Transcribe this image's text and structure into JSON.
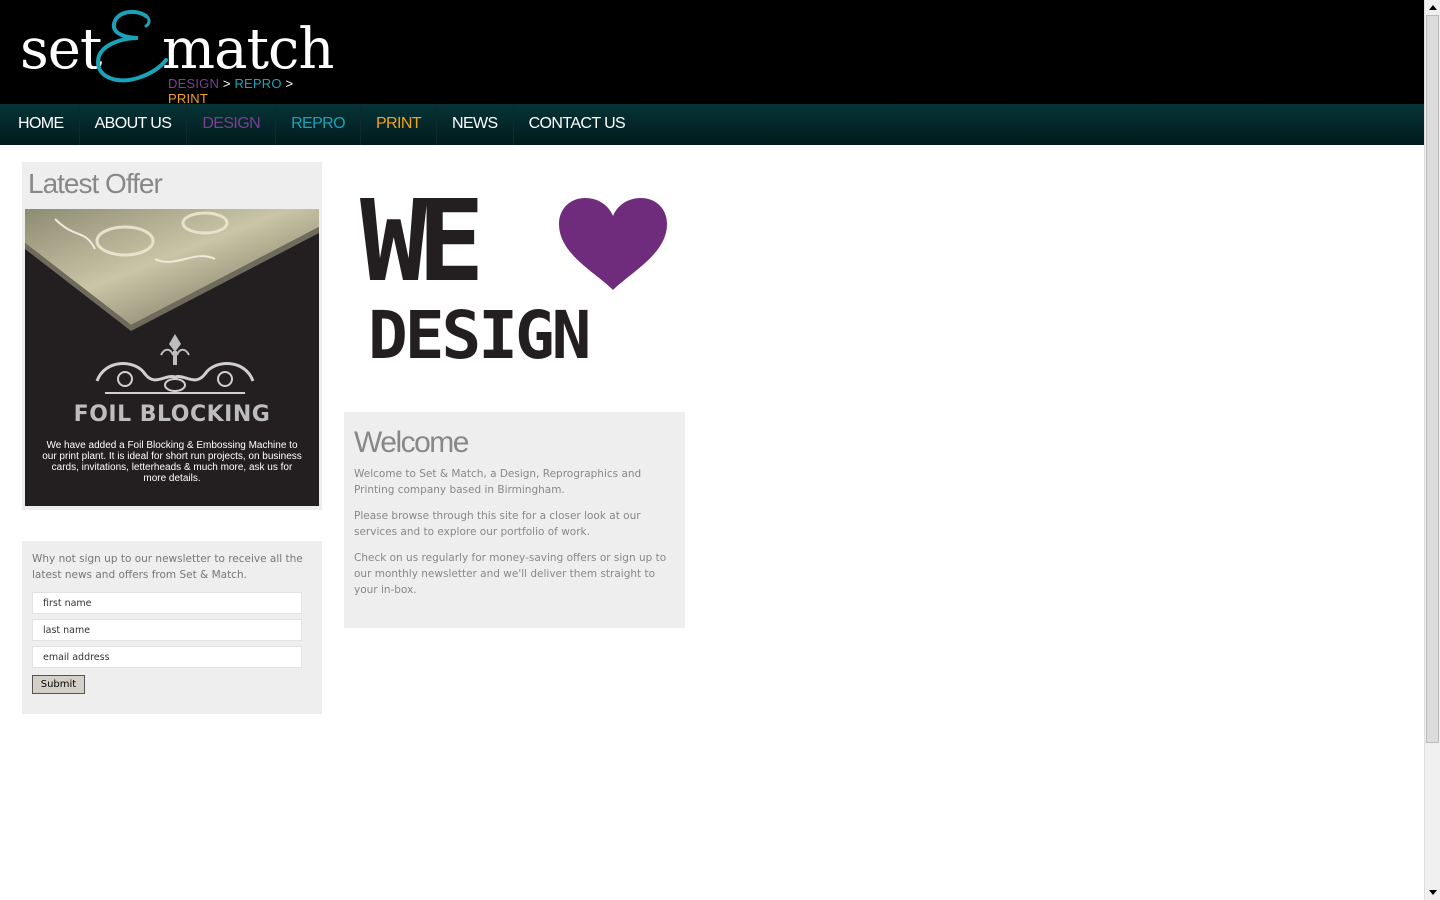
{
  "logo": {
    "word_left": "set",
    "word_right": "match",
    "tag_design": "DESIGN",
    "tag_sep1": " > ",
    "tag_repro": "REPRO",
    "tag_sep2": " > ",
    "tag_print": "PRINT",
    "colors": {
      "design": "#7a3f93",
      "repro": "#1aa3b8",
      "print": "#f3a21b",
      "ampersand": "#1aa3b8"
    }
  },
  "nav": {
    "items": [
      {
        "label": "HOME"
      },
      {
        "label": "ABOUT US"
      },
      {
        "label": "DESIGN"
      },
      {
        "label": "REPRO"
      },
      {
        "label": "PRINT"
      },
      {
        "label": "NEWS"
      },
      {
        "label": "CONTACT US"
      }
    ]
  },
  "offer": {
    "title": "Latest Offer",
    "image_title": "FOIL BLOCKING",
    "image_text": "We have added a Foil Blocking & Embossing Machine to our print plant. It is ideal for short run projects, on business cards, invitations, letterheads & much more, ask us for more details."
  },
  "newsletter": {
    "intro": "Why not sign up to our newsletter to receive all the latest news and offers from Set & Match.",
    "first_name_value": "first name",
    "last_name_value": "last name",
    "email_value": "email address",
    "submit_label": "Submit"
  },
  "hero": {
    "line1": "WE",
    "line2": "DESIGN",
    "heart_color": "#702c7c",
    "icon": "heart-icon"
  },
  "welcome": {
    "title": "Welcome",
    "paragraphs": [
      "Welcome to Set & Match, a Design, Reprographics and Printing company based in Birmingham.",
      "Please browse through this site for a closer look at our services and to explore our portfolio of work.",
      "Check on us regularly for money-saving offers or sign up to our monthly newsletter and we'll deliver them straight to your in-box."
    ]
  }
}
